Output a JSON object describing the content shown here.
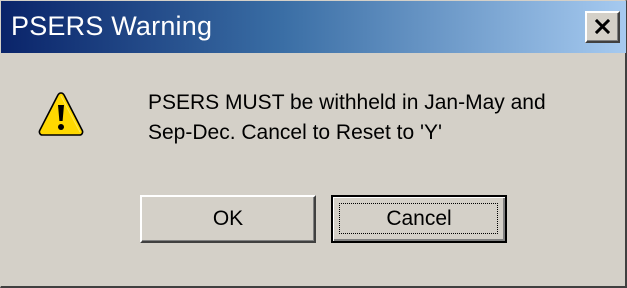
{
  "dialog": {
    "title": "PSERS Warning",
    "close_label": "×",
    "message": "PSERS MUST be withheld in Jan-May and\nSep-Dec.  Cancel to Reset to 'Y'",
    "icon": "warning-icon",
    "buttons": {
      "ok_label": "OK",
      "cancel_label": "Cancel"
    },
    "colors": {
      "titlebar_start": "#0a246a",
      "titlebar_end": "#a6caf0",
      "face": "#d4d0c8",
      "warning_yellow": "#ffd800"
    }
  }
}
